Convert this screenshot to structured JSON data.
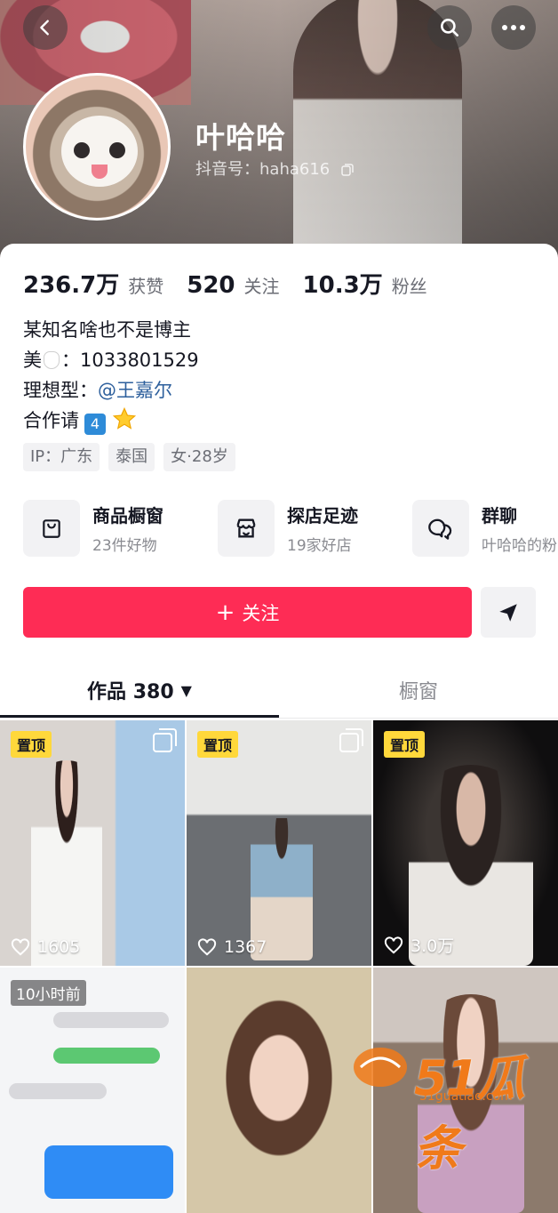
{
  "header": {
    "nickname": "叶哈哈",
    "douyin_id": "抖音号：haha616"
  },
  "stats": [
    {
      "value": "236.7万",
      "label": "获赞"
    },
    {
      "value": "520",
      "label": "关注"
    },
    {
      "value": "10.3万",
      "label": "粉丝"
    }
  ],
  "bio": {
    "line1": "某知名啥也不是博主",
    "line2_prefix": "美",
    "line2_suffix": "：1033801529",
    "line3_prefix": "理想型：",
    "line3_mention": "@王嘉尔",
    "line4_prefix": "合作请",
    "line4_badge": "4"
  },
  "tags": [
    "IP：广东",
    "泰国",
    "女·28岁"
  ],
  "entries": [
    {
      "title": "商品橱窗",
      "sub": "23件好物"
    },
    {
      "title": "探店足迹",
      "sub": "19家好店"
    },
    {
      "title": "群聊",
      "sub": "叶哈哈的粉"
    }
  ],
  "actions": {
    "follow": "关注"
  },
  "tabs": {
    "works": "作品 380",
    "window": "橱窗"
  },
  "grid": [
    {
      "pin": "置顶",
      "likes": "1605"
    },
    {
      "pin": "置顶",
      "likes": "1367"
    },
    {
      "pin": "置顶",
      "likes": "3.0万"
    },
    {
      "time": "10小时前"
    },
    {},
    {}
  ],
  "watermark": {
    "text": "51瓜条",
    "url": "51guatiao.com"
  },
  "colors": {
    "primary": "#fe2c55",
    "mention": "#2d5f9c",
    "pin": "#ffd83b",
    "watermark": "#f07a1a"
  }
}
